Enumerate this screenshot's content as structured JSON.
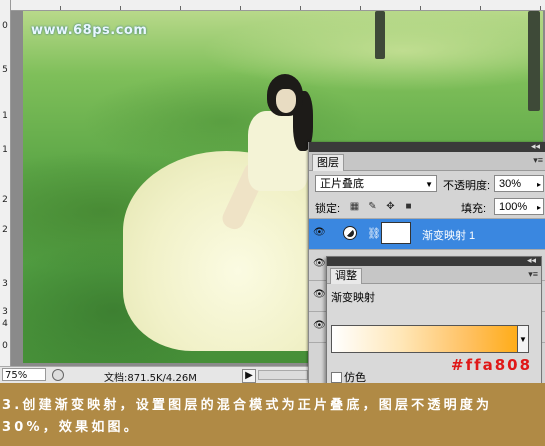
{
  "watermark": "www.68ps.com",
  "ruler": {
    "left_ticks": [
      "0",
      "5",
      "1",
      "1",
      "2",
      "2",
      "3",
      "3",
      "4"
    ],
    "bottom_tick": "0"
  },
  "status": {
    "zoom": "75%",
    "doc_info": "文档:871.5K/4.26M",
    "play_icon": "play-triangle"
  },
  "layers_panel": {
    "tab_label": "图层",
    "blend_mode": "正片叠底",
    "opacity_label": "不透明度:",
    "opacity_value": "30%",
    "lock_label": "锁定:",
    "fill_label": "填充:",
    "fill_value": "100%",
    "selected_layer_name": "渐变映射 1"
  },
  "adjustments_panel": {
    "tab_label": "调整",
    "title": "渐变映射",
    "dither_label": "仿色"
  },
  "hex_annotation": "#ffa808",
  "caption": "3.创建渐变映射，设置图层的混合模式为正片叠底，图层不透明度为30%，效果如图。",
  "colors": {
    "gradient_start": "#ffffff",
    "gradient_end": "#ffa808",
    "caption_band": "#b08a45",
    "selected_layer": "#3a87e0"
  }
}
